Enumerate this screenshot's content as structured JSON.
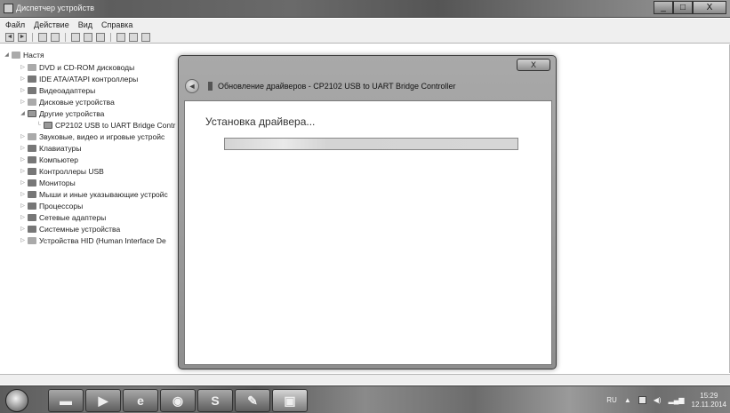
{
  "window": {
    "title": "Диспетчер устройств",
    "buttons": {
      "minimize": "_",
      "maximize": "□",
      "close": "X"
    }
  },
  "menu": [
    "Файл",
    "Действие",
    "Вид",
    "Справка"
  ],
  "toolbar": {
    "icons": [
      "back-icon",
      "forward-icon",
      "properties-icon",
      "help-icon",
      "update-driver-icon",
      "uninstall-icon",
      "scan-icon"
    ]
  },
  "tree": {
    "root": "Настя",
    "items": [
      {
        "label": "DVD и CD-ROM дисководы",
        "icon": "dvd-drive-icon"
      },
      {
        "label": "IDE ATA/ATAPI контроллеры",
        "icon": "ide-controller-icon"
      },
      {
        "label": "Видеоадаптеры",
        "icon": "display-adapter-icon"
      },
      {
        "label": "Дисковые устройства",
        "icon": "disk-drive-icon"
      },
      {
        "label": "Другие устройства",
        "icon": "other-devices-icon"
      },
      {
        "label": "CP2102 USB to UART Bridge Contr",
        "icon": "unknown-device-icon"
      },
      {
        "label": "Звуковые, видео и игровые устройс",
        "icon": "sound-icon"
      },
      {
        "label": "Клавиатуры",
        "icon": "keyboard-icon"
      },
      {
        "label": "Компьютер",
        "icon": "computer-icon"
      },
      {
        "label": "Контроллеры USB",
        "icon": "usb-icon"
      },
      {
        "label": "Мониторы",
        "icon": "monitor-icon"
      },
      {
        "label": "Мыши и иные указывающие устройс",
        "icon": "mouse-icon"
      },
      {
        "label": "Процессоры",
        "icon": "processor-icon"
      },
      {
        "label": "Сетевые адаптеры",
        "icon": "network-icon"
      },
      {
        "label": "Системные устройства",
        "icon": "system-devices-icon"
      },
      {
        "label": "Устройства HID (Human Interface De",
        "icon": "hid-icon"
      }
    ]
  },
  "dialog": {
    "close": "X",
    "title": "Обновление драйверов - CP2102 USB to UART Bridge Controller",
    "heading": "Установка драйвера...",
    "progress": 0.0
  },
  "taskbar": {
    "apps": [
      {
        "name": "explorer",
        "glyph": "▬"
      },
      {
        "name": "media-player",
        "glyph": "▶"
      },
      {
        "name": "internet-explorer",
        "glyph": "e"
      },
      {
        "name": "browser",
        "glyph": "◉"
      },
      {
        "name": "skype",
        "glyph": "S"
      },
      {
        "name": "paint",
        "glyph": "✎"
      },
      {
        "name": "device-manager",
        "glyph": "▣"
      }
    ],
    "language": "RU",
    "time": "15:29",
    "date": "12.11.2014"
  }
}
